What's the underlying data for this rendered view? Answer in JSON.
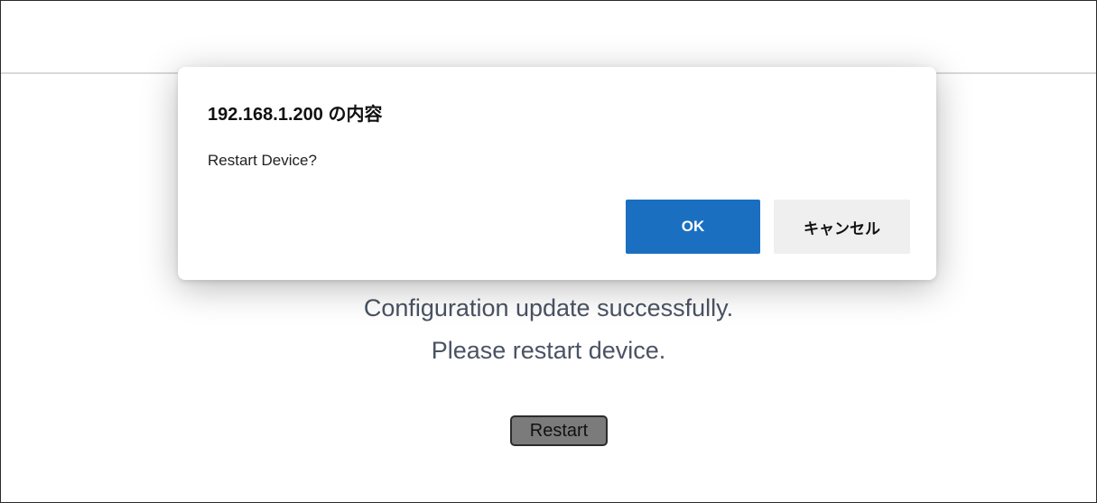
{
  "page": {
    "message_line1": "Configuration update successfully.",
    "message_line2": "Please restart device.",
    "restart_button": "Restart"
  },
  "dialog": {
    "title": "192.168.1.200 の内容",
    "message": "Restart Device?",
    "ok_label": "OK",
    "cancel_label": "キャンセル"
  },
  "colors": {
    "ok_button": "#1b6fc0",
    "cancel_button": "#efefef",
    "page_text": "#4a5363",
    "restart_button": "#7b7b7b"
  }
}
